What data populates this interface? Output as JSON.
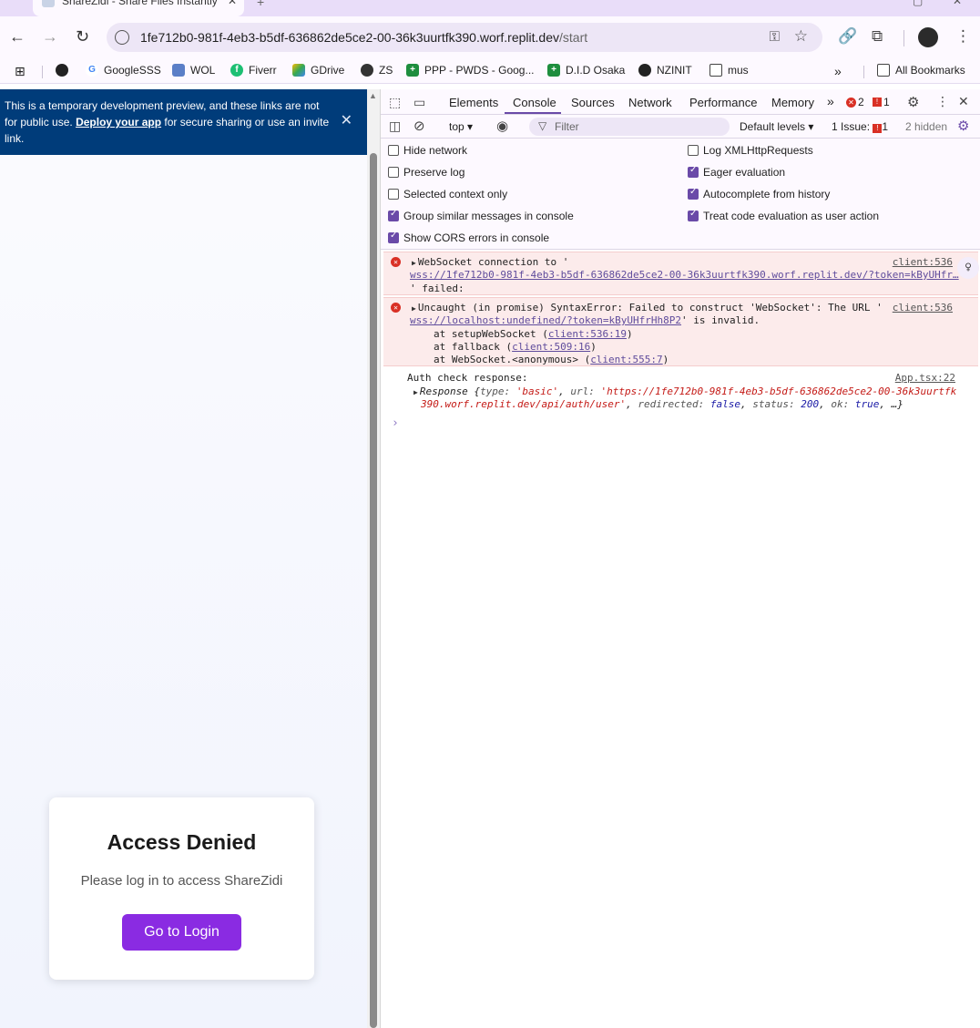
{
  "browser": {
    "tab_title": "ShareZidi - Share Files Instantly",
    "new_tab": "+",
    "url_host": "1fe712b0-981f-4eb3-b5df-636862de5ce2-00-36k3uurtfk390.worf.replit.dev",
    "url_path": "/start",
    "nav": {
      "back": "←",
      "forward": "→",
      "reload": "↻"
    },
    "bookmarks": [
      {
        "label": "",
        "icon": "globe-icon"
      },
      {
        "label": "GoogleSSS",
        "icon": "google-icon"
      },
      {
        "label": "WOL",
        "icon": "wol-icon"
      },
      {
        "label": "Fiverr",
        "icon": "fiverr-icon"
      },
      {
        "label": "GDrive",
        "icon": "gdrive-icon"
      },
      {
        "label": "ZS",
        "icon": "zs-icon"
      },
      {
        "label": "PPP - PWDS - Goog...",
        "icon": "sheets-icon"
      },
      {
        "label": "D.I.D Osaka",
        "icon": "sheets-icon"
      },
      {
        "label": "NZINIT",
        "icon": "globe-icon"
      },
      {
        "label": "mus",
        "icon": "folder-icon"
      }
    ],
    "bookmarks_overflow": "»",
    "all_bookmarks": "All Bookmarks"
  },
  "page": {
    "banner_text_1": "This is a temporary development preview, and these links are not for public use.",
    "banner_link": "Deploy your app",
    "banner_text_2": "for secure sharing or use an invite link.",
    "card_title": "Access Denied",
    "card_message": "Please log in to access ShareZidi",
    "login_button": "Go to Login"
  },
  "devtools": {
    "tabs": [
      "Elements",
      "Console",
      "Sources",
      "Network",
      "Performance",
      "Memory"
    ],
    "active_tab": "Console",
    "more_tabs": "»",
    "error_count": "2",
    "issue_count": "1",
    "context": "top ▾",
    "filter_placeholder": "Filter",
    "levels": "Default levels ▾",
    "issues_label": "1 Issue:",
    "issues_count": "1",
    "hidden": "2 hidden",
    "settings_left": [
      {
        "label": "Hide network",
        "checked": false
      },
      {
        "label": "Preserve log",
        "checked": false
      },
      {
        "label": "Selected context only",
        "checked": false
      },
      {
        "label": "Group similar messages in console",
        "checked": true
      },
      {
        "label": "Show CORS errors in console",
        "checked": true
      }
    ],
    "settings_right": [
      {
        "label": "Log XMLHttpRequests",
        "checked": false
      },
      {
        "label": "Eager evaluation",
        "checked": true
      },
      {
        "label": "Autocomplete from history",
        "checked": true
      },
      {
        "label": "Treat code evaluation as user action",
        "checked": true
      }
    ],
    "messages": {
      "err1_line1": "WebSocket connection to '",
      "err1_link": "wss://1fe712b0-981f-4eb3-b5df-636862de5ce2-00-36k3uurtfk390.worf.replit.dev/?token=kByUHfr…",
      "err1_line3": "' failed:",
      "err1_src": "client:536",
      "err2_line1": "Uncaught (in promise) SyntaxError: Failed to construct 'WebSocket': The URL '",
      "err2_link": "wss://localhost:undefined/?token=kByUHfrHh8P2",
      "err2_tail": "' is invalid.",
      "err2_src": "client:536",
      "stack": [
        {
          "prefix": "at setupWebSocket (",
          "link": "client:536:19",
          "suffix": ")"
        },
        {
          "prefix": "at fallback (",
          "link": "client:509:16",
          "suffix": ")"
        },
        {
          "prefix": "at WebSocket.<anonymous> (",
          "link": "client:555:7",
          "suffix": ")"
        }
      ],
      "log_text": "Auth check response:",
      "log_src": "App.tsx:22",
      "resp_name": "Response",
      "resp_type_key": "type:",
      "resp_type_val": "'basic'",
      "resp_url_key": "url:",
      "resp_url_val_1": "'https://1fe712b0-981f-4eb3-b5df-636862de5ce2-00-36k3uurtfk",
      "resp_url_val_2": "390.worf.replit.dev/api/auth/user'",
      "resp_redirected_key": "redirected:",
      "resp_redirected_val": "false",
      "resp_status_key": "status:",
      "resp_status_val": "200",
      "resp_ok_key": "ok:",
      "resp_ok_val": "true",
      "resp_more": ", …}"
    },
    "prompt": "›"
  },
  "colors": {
    "banner": "#003c7a",
    "login_button": "#8a2be2",
    "error_bg": "#fcebeb"
  }
}
